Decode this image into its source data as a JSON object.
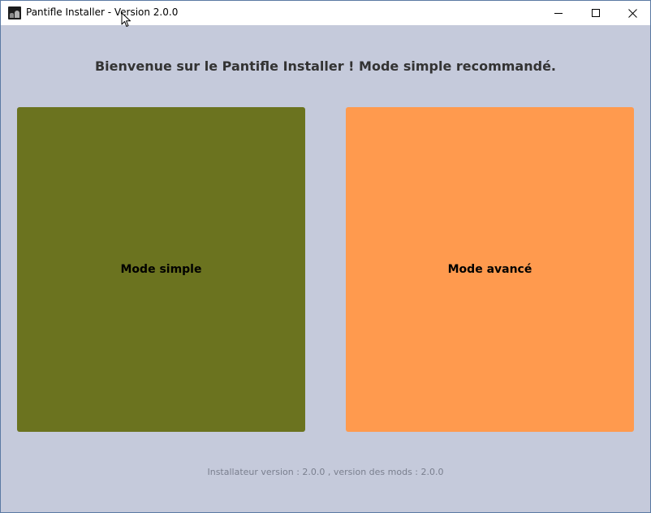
{
  "window": {
    "title": "Pantifle Installer - Version 2.0.0",
    "controls": [
      "minimize-icon",
      "maximize-icon",
      "close-icon"
    ]
  },
  "main": {
    "heading": "Bienvenue sur le Pantifle Installer ! Mode simple recommandé.",
    "simple_button": {
      "label": "Mode simple",
      "color": "#6b731f"
    },
    "advanced_button": {
      "label": "Mode avancé",
      "color": "#ff9a4e"
    }
  },
  "footer": {
    "version_text": "Installateur version : 2.0.0 , version des mods : 2.0.0"
  },
  "colors": {
    "background": "#c5cadb",
    "titlebar": "#ffffff",
    "heading_text": "#333333",
    "footer_text": "#7a7f8e"
  }
}
